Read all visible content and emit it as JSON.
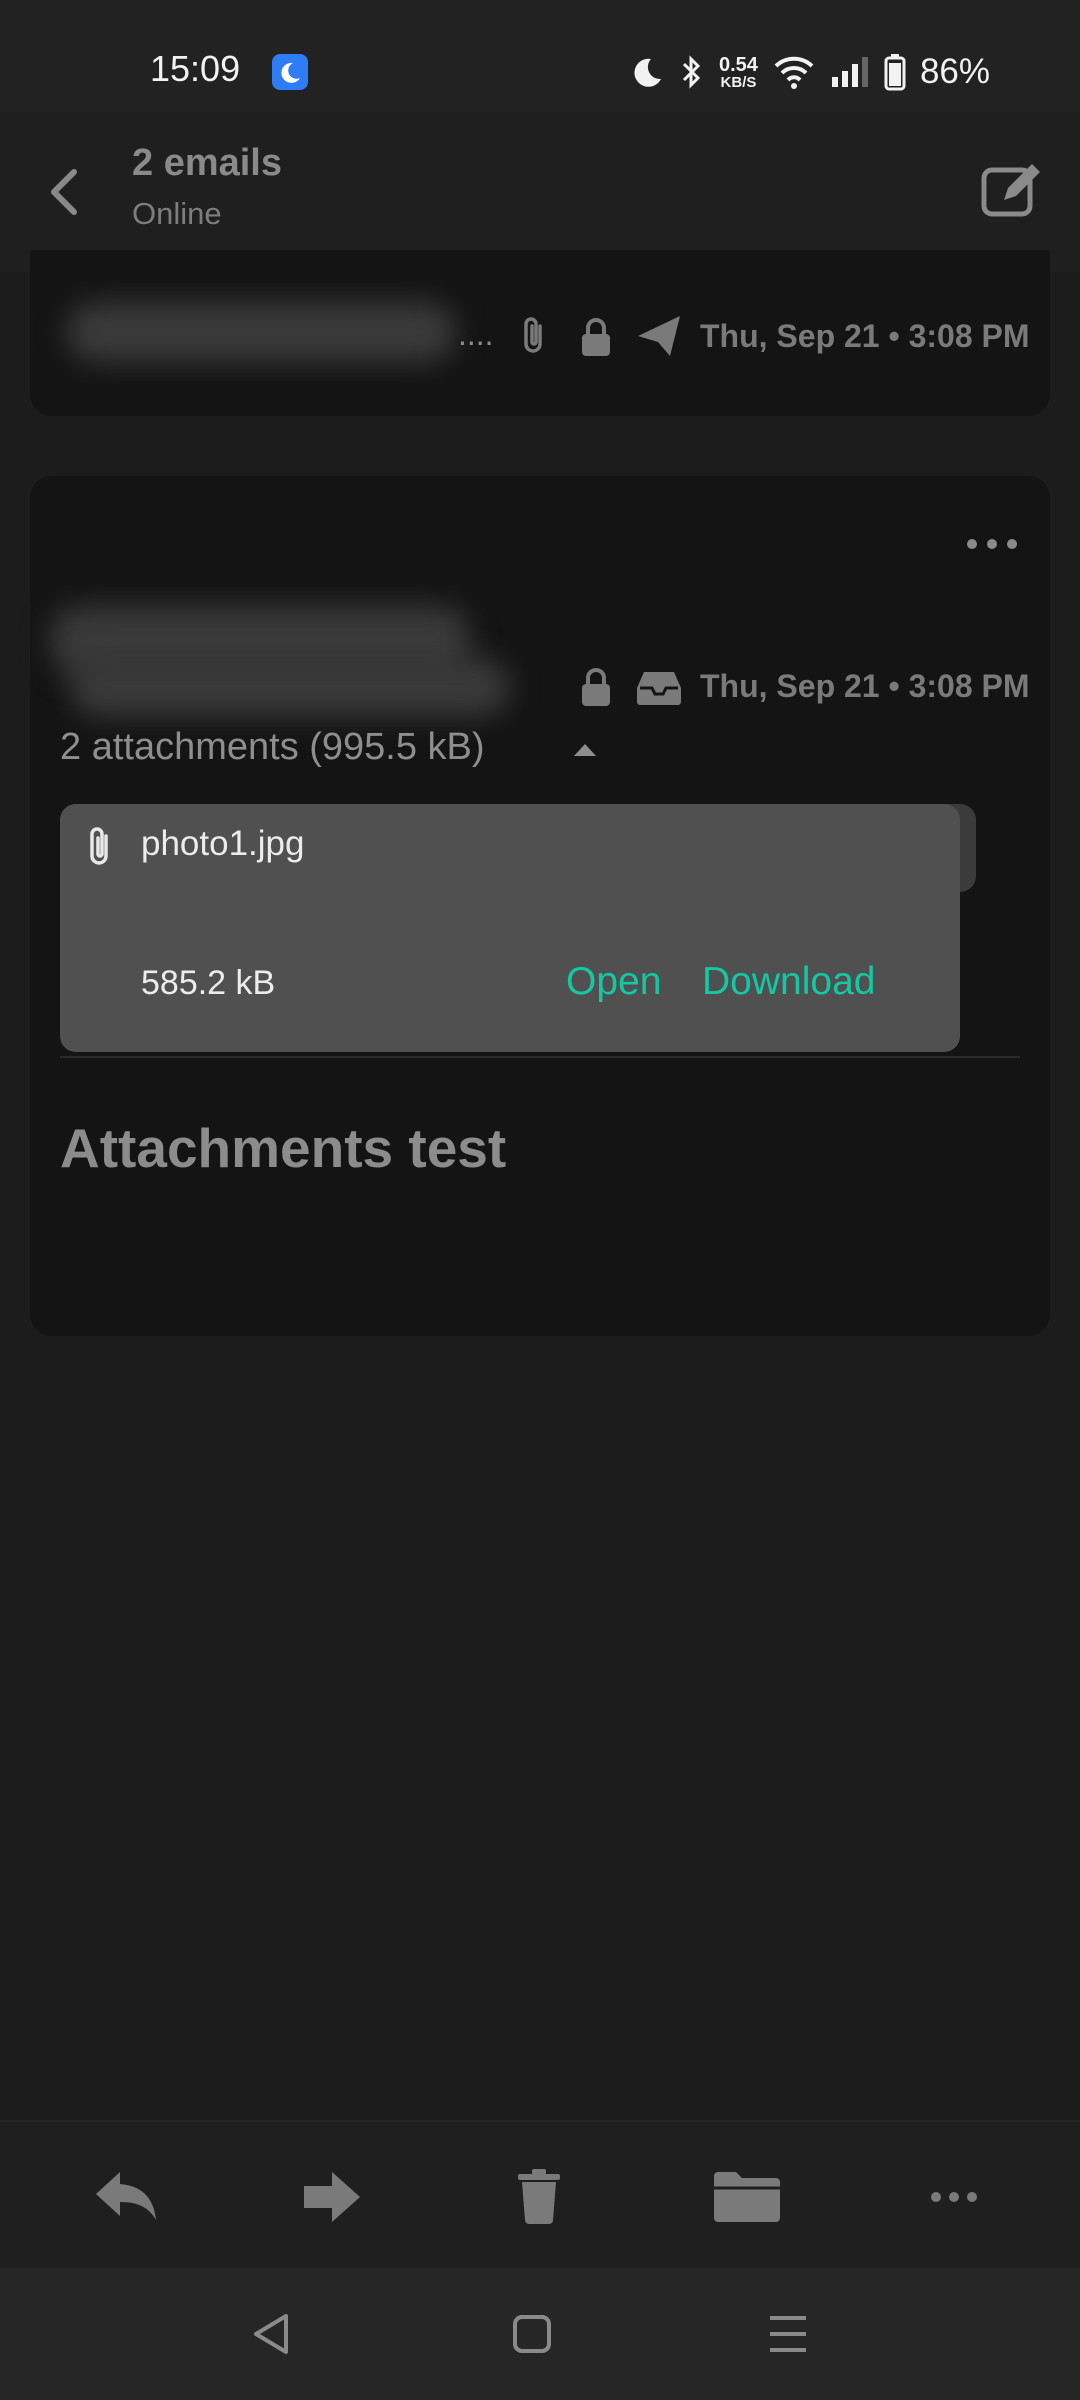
{
  "status_bar": {
    "time": "15:09",
    "net_speed_value": "0.54",
    "net_speed_unit": "KB/S",
    "battery": "86%"
  },
  "header": {
    "title": "2 emails",
    "subtitle": "Online"
  },
  "message1": {
    "ellipsis": "....",
    "date": "Thu, Sep 21 • 3:08 PM"
  },
  "message2": {
    "date": "Thu, Sep 21 • 3:08 PM",
    "attachments_summary": "2 attachments (995.5 kB)",
    "attachment": {
      "name": "photo1.jpg",
      "size": "585.2 kB",
      "open_label": "Open",
      "download_label": "Download"
    },
    "subject": "Attachments test"
  },
  "colors": {
    "accent": "#12c9a4",
    "background": "#1c1c1c",
    "card": "#141414"
  }
}
